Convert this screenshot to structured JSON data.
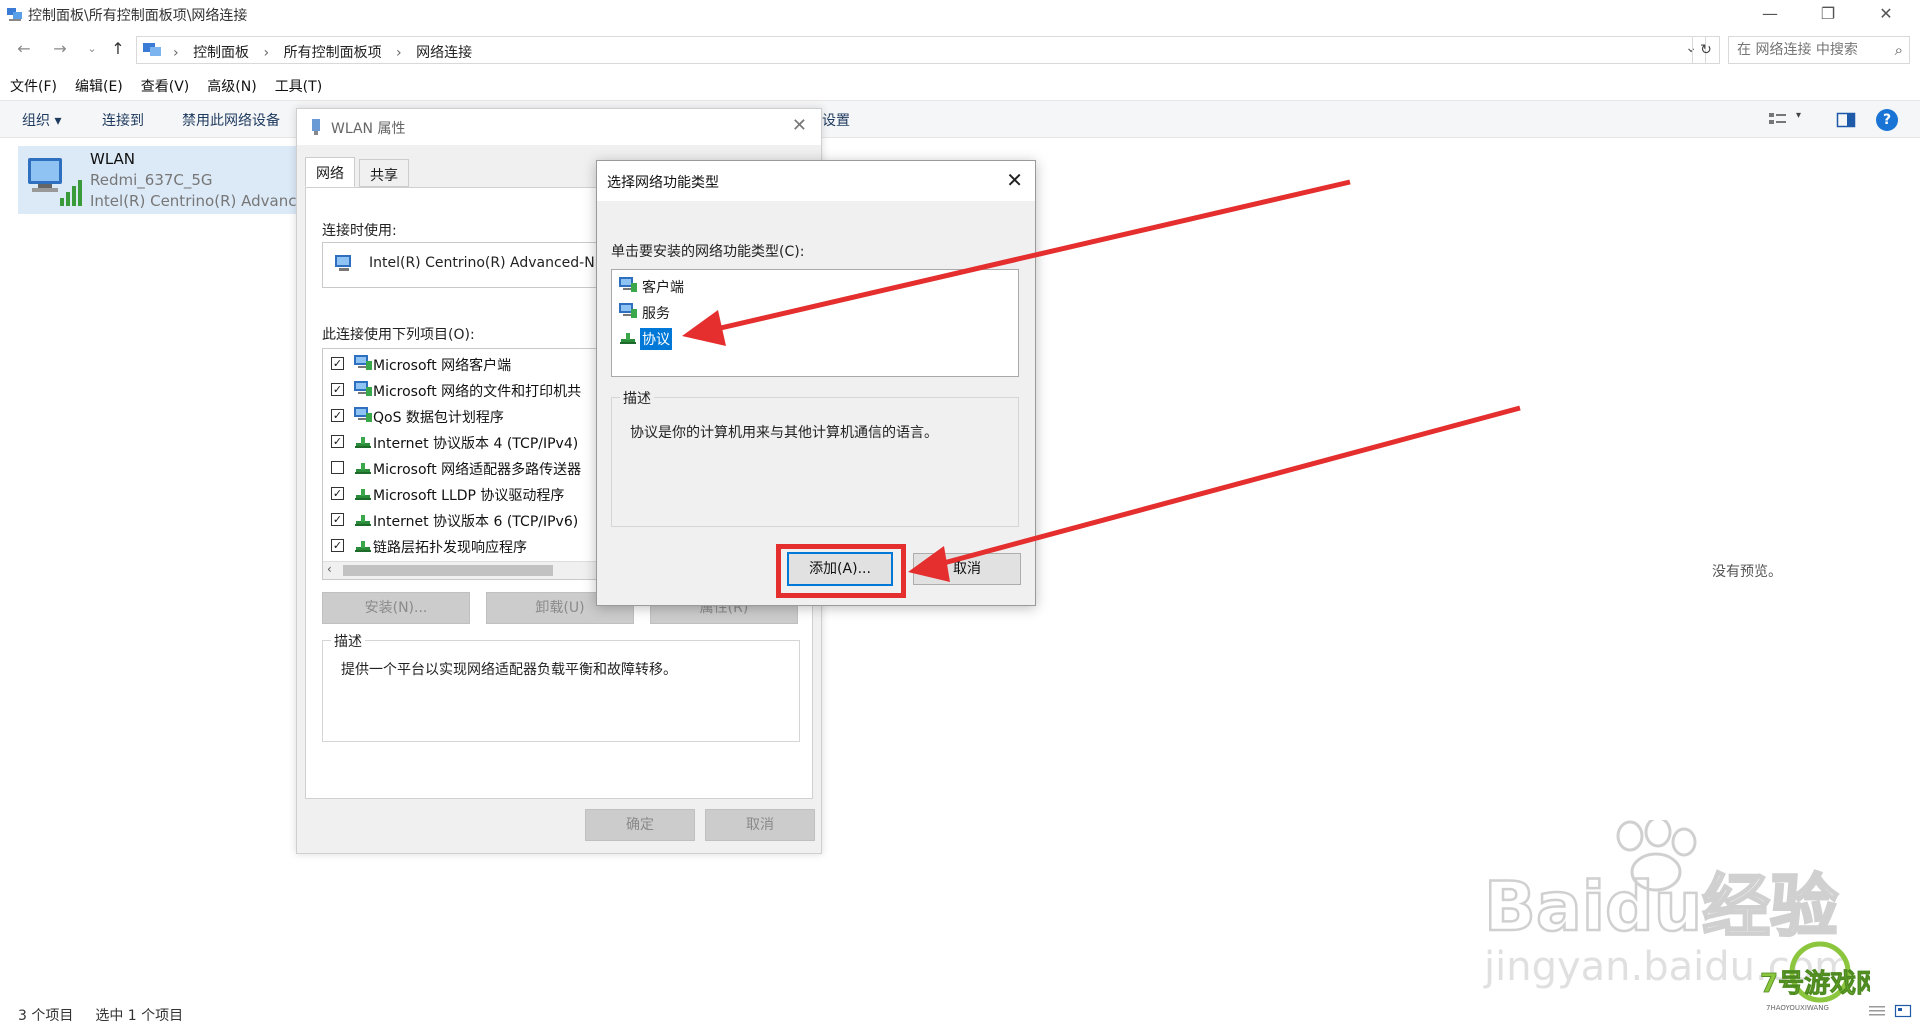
{
  "window": {
    "title": "控制面板\\所有控制面板项\\网络连接"
  },
  "nav": {
    "crumbs": [
      "控制面板",
      "所有控制面板项",
      "网络连接"
    ],
    "search_placeholder": "在 网络连接 中搜索"
  },
  "menu": [
    "文件(F)",
    "编辑(E)",
    "查看(V)",
    "高级(N)",
    "工具(T)"
  ],
  "commands": {
    "organize": "组织 ▾",
    "connect": "连接到",
    "disable": "禁用此网络设备",
    "settings_tail": "设置",
    "help": "?"
  },
  "connection": {
    "name": "WLAN",
    "ssid": "Redmi_637C_5G",
    "adapter": "Intel(R) Centrino(R) Advance"
  },
  "preview": {
    "empty_text": "没有预览。"
  },
  "status": {
    "items_count": "3 个项目",
    "selected": "选中 1 个项目"
  },
  "wlan_props": {
    "title": "WLAN 属性",
    "tabs": [
      "网络",
      "共享"
    ],
    "connect_using_label": "连接时使用:",
    "adapter": "Intel(R) Centrino(R) Advanced-N",
    "items_label": "此连接使用下列项目(O):",
    "items": [
      {
        "checked": true,
        "icon": "network-client-icon",
        "label": "Microsoft 网络客户端"
      },
      {
        "checked": true,
        "icon": "network-service-icon",
        "label": "Microsoft 网络的文件和打印机共"
      },
      {
        "checked": true,
        "icon": "network-service-icon",
        "label": "QoS 数据包计划程序"
      },
      {
        "checked": true,
        "icon": "protocol-icon",
        "label": "Internet 协议版本 4 (TCP/IPv4)"
      },
      {
        "checked": false,
        "icon": "protocol-icon",
        "label": "Microsoft 网络适配器多路传送器"
      },
      {
        "checked": true,
        "icon": "protocol-icon",
        "label": "Microsoft LLDP 协议驱动程序"
      },
      {
        "checked": true,
        "icon": "protocol-icon",
        "label": "Internet 协议版本 6 (TCP/IPv6)"
      },
      {
        "checked": true,
        "icon": "protocol-icon",
        "label": "链路层拓扑发现响应程序"
      }
    ],
    "install": "安装(N)...",
    "uninstall": "卸载(U)",
    "properties": "属性(R)",
    "desc_label": "描述",
    "desc_text": "提供一个平台以实现网络适配器负载平衡和故障转移。",
    "ok": "确定",
    "cancel": "取消"
  },
  "feature_dialog": {
    "title": "选择网络功能类型",
    "prompt": "单击要安装的网络功能类型(C):",
    "types": [
      {
        "icon": "client-icon",
        "label": "客户端",
        "selected": false
      },
      {
        "icon": "service-icon",
        "label": "服务",
        "selected": false
      },
      {
        "icon": "protocol-icon",
        "label": "协议",
        "selected": true
      }
    ],
    "desc_label": "描述",
    "desc_text": "协议是你的计算机用来与其他计算机通信的语言。",
    "add": "添加(A)...",
    "cancel": "取消"
  },
  "watermark": {
    "brand": "Baidu经验",
    "url": "jingyan.baidu.com",
    "logo2": "7号游戏网",
    "logo2_sub": "7HAOYOUXIWANG"
  },
  "colors": {
    "accent": "#0078d7",
    "highlight": "#e52e2e",
    "help": "#1a74d6"
  }
}
